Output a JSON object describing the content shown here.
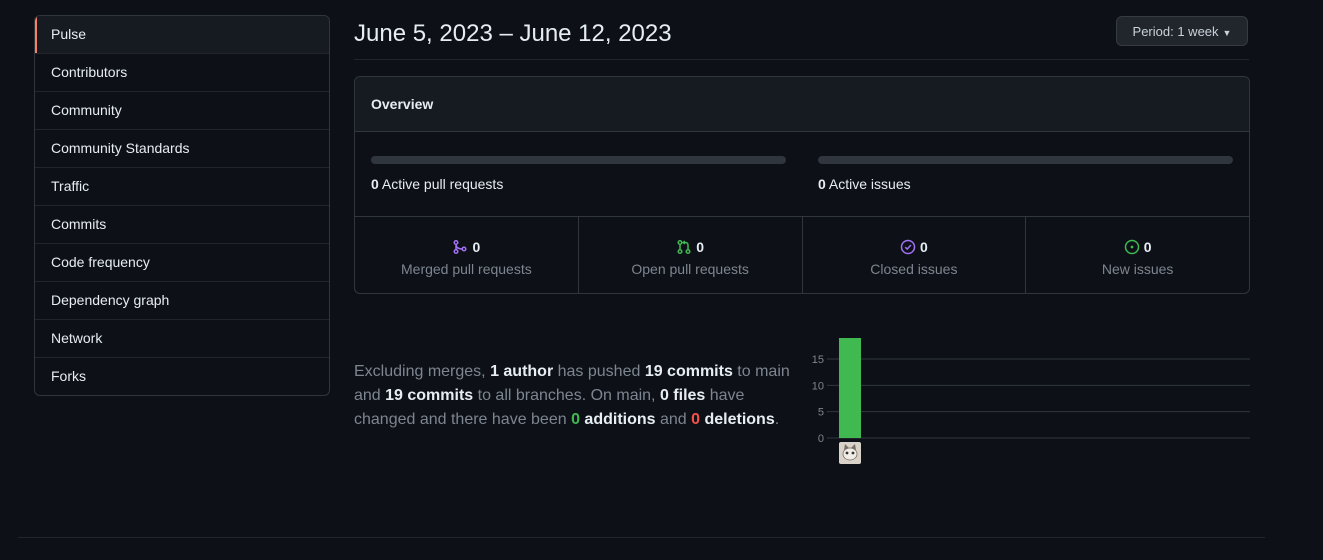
{
  "sidebar": {
    "items": [
      {
        "label": "Pulse",
        "selected": true
      },
      {
        "label": "Contributors"
      },
      {
        "label": "Community"
      },
      {
        "label": "Community Standards"
      },
      {
        "label": "Traffic"
      },
      {
        "label": "Commits"
      },
      {
        "label": "Code frequency"
      },
      {
        "label": "Dependency graph"
      },
      {
        "label": "Network"
      },
      {
        "label": "Forks"
      }
    ]
  },
  "header": {
    "date_range": "June 5, 2023 – June 12, 2023",
    "period_label": "Period: 1 week"
  },
  "overview": {
    "title": "Overview",
    "active_prs": {
      "count": "0",
      "label": "Active pull requests",
      "fraction": 0
    },
    "active_issues": {
      "count": "0",
      "label": "Active issues",
      "fraction": 0
    },
    "stats": [
      {
        "count": "0",
        "label": "Merged pull requests",
        "icon": "merged-pr-icon",
        "color": "#a371f7"
      },
      {
        "count": "0",
        "label": "Open pull requests",
        "icon": "open-pr-icon",
        "color": "#3fb950"
      },
      {
        "count": "0",
        "label": "Closed issues",
        "icon": "closed-issue-icon",
        "color": "#a371f7"
      },
      {
        "count": "0",
        "label": "New issues",
        "icon": "new-issue-icon",
        "color": "#3fb950"
      }
    ]
  },
  "summary": {
    "p1": "Excluding merges, ",
    "authors": "1 author",
    "p2": " has pushed ",
    "commits_main": "19 commits",
    "p3": " to main and ",
    "commits_all": "19 commits",
    "p4": " to all branches. On main, ",
    "files": "0 files",
    "p5": " have changed and there have been ",
    "additions_count": "0",
    "additions_word": " additions",
    "p6": " and ",
    "deletions_count": "0",
    "deletions_word": " deletions",
    "p7": "."
  },
  "chart_data": {
    "type": "bar",
    "categories": [
      "author-1"
    ],
    "values": [
      19
    ],
    "ylim": [
      0,
      19
    ],
    "yticks": [
      0,
      5,
      10,
      15
    ],
    "grid": true,
    "bar_color": "#3fb950"
  }
}
